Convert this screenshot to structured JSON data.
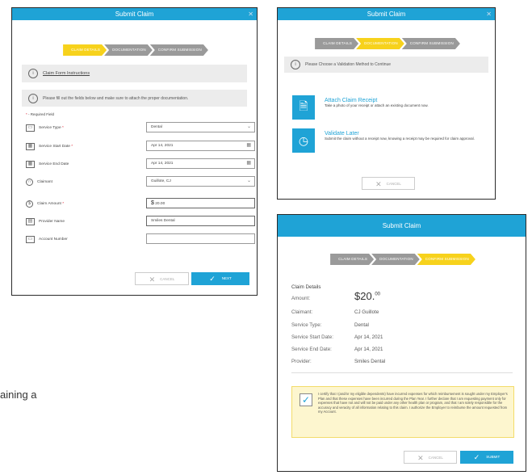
{
  "claim_form": {
    "title": "Submit Claim",
    "steps": [
      "CLAIM DETAILS",
      "DOCUMENTATION",
      "CONFIRM SUBMISSION"
    ],
    "instructions_link": "Claim Form Instructions",
    "info_text": "Please fill out the fields below and make sure to attach the proper documentation.",
    "required_note": "- Required Field",
    "fields": [
      {
        "label": "Service Type",
        "required": true,
        "value": "Dental",
        "icon": "service-type-icon",
        "control": "select"
      },
      {
        "label": "Service Start Date",
        "required": true,
        "value": "Apr 14, 2021",
        "icon": "calendar-icon",
        "control": "date"
      },
      {
        "label": "Service End Date",
        "required": false,
        "value": "Apr 14, 2021",
        "icon": "calendar-icon",
        "control": "date"
      },
      {
        "label": "Claimant",
        "required": false,
        "value": "Guillote, CJ",
        "icon": "person-icon",
        "control": "select"
      },
      {
        "label": "Claim Amount",
        "required": true,
        "value": "20.00",
        "icon": "dollar-icon",
        "control": "money"
      },
      {
        "label": "Provider Name",
        "required": false,
        "value": "Smiles Dental",
        "icon": "provider-icon",
        "control": "text"
      },
      {
        "label": "Account Number",
        "required": false,
        "value": "",
        "icon": "account-icon",
        "control": "text"
      }
    ],
    "cancel_label": "CANCEL",
    "next_label": "NEXT"
  },
  "validation": {
    "title": "Submit Claim",
    "steps": [
      "CLAIM DETAILS",
      "DOCUMENTATION",
      "CONFIRM SUBMISSION"
    ],
    "info_text": "Please Choose a Validation Method to Continue",
    "options": [
      {
        "title": "Attach Claim Receipt",
        "desc": "Take a photo of your receipt or attach an existing document now."
      },
      {
        "title": "Validate Later",
        "desc": "Submit the claim without a receipt now, knowing a receipt may be required for claim approval."
      }
    ],
    "cancel_label": "CANCEL"
  },
  "confirm": {
    "title": "Submit Claim",
    "steps": [
      "CLAIM DETAILS",
      "DOCUMENTATION",
      "CONFIRM SUBMISSION"
    ],
    "section_title": "Claim Details",
    "amount_label": "Amount:",
    "amount_main": "$20.",
    "amount_cents": "00",
    "details": [
      {
        "label": "Claimant:",
        "value": "CJ Guillote"
      },
      {
        "label": "Service Type:",
        "value": "Dental"
      },
      {
        "label": "Service Start Date:",
        "value": "Apr 14, 2021"
      },
      {
        "label": "Service End Date:",
        "value": "Apr 14, 2021"
      },
      {
        "label": "Provider:",
        "value": "Smiles Dental"
      }
    ],
    "certify_text": "I certify that I (and/or my eligible dependents) have incurred expenses for which reimbursement is sought under my Employer's Plan and that these expenses have been incurred during the Plan Year. I further declare that I am requesting payment only for expenses that have not and will not be paid under any other health plan or program, and that I am solely responsible for the accuracy and veracity of all information relating to this claim. I authorize the Employer to reimburse the amount requested from my Account.",
    "cancel_label": "CANCEL",
    "submit_label": "SUBMIT"
  },
  "caption_text": "aining a",
  "colors": {
    "accent": "#1fa3d6",
    "active_step": "#f7d21c",
    "inactive_step": "#9a9a9a"
  }
}
